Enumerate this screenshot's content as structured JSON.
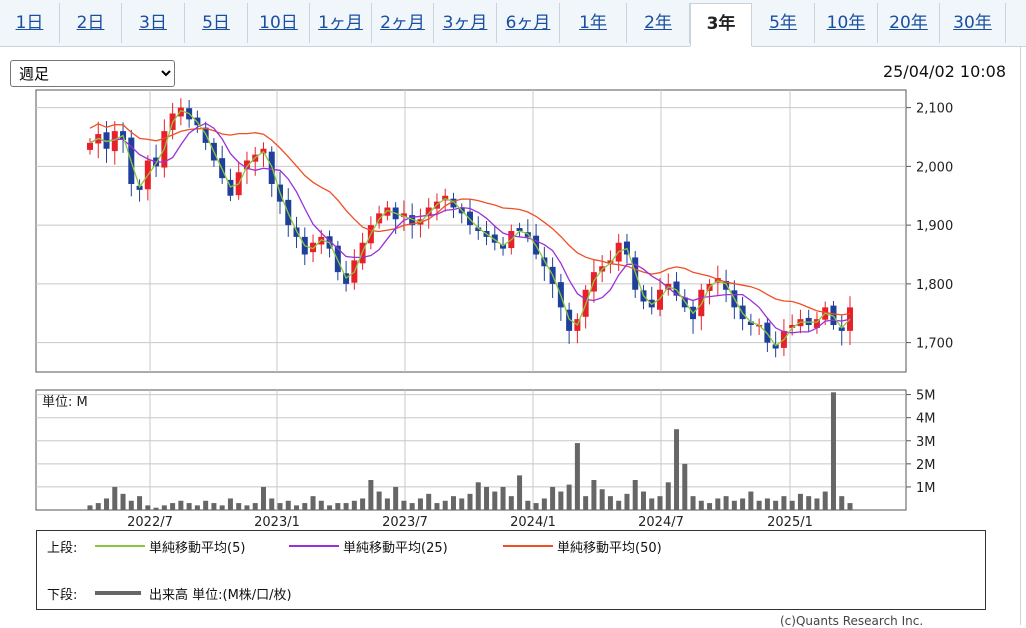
{
  "tabs": [
    {
      "label": "1日",
      "active": false
    },
    {
      "label": "2日",
      "active": false
    },
    {
      "label": "3日",
      "active": false
    },
    {
      "label": "5日",
      "active": false
    },
    {
      "label": "10日",
      "active": false
    },
    {
      "label": "1ヶ月",
      "active": false
    },
    {
      "label": "2ヶ月",
      "active": false
    },
    {
      "label": "3ヶ月",
      "active": false
    },
    {
      "label": "6ヶ月",
      "active": false
    },
    {
      "label": "1年",
      "active": false
    },
    {
      "label": "2年",
      "active": false
    },
    {
      "label": "3年",
      "active": true
    },
    {
      "label": "5年",
      "active": false
    },
    {
      "label": "10年",
      "active": false
    },
    {
      "label": "20年",
      "active": false
    },
    {
      "label": "30年",
      "active": false
    }
  ],
  "period_select": {
    "value": "週足"
  },
  "timestamp": "25/04/02 10:08",
  "legend": {
    "upper_label": "上段:",
    "ma5": "単純移動平均(5)",
    "ma25": "単純移動平均(25)",
    "ma50": "単純移動平均(50)",
    "lower_label": "下段:",
    "volume": "出来高 単位:(M株/口/枚)"
  },
  "copyright": "(c)Quants Research Inc.",
  "colors": {
    "up": "#e8202a",
    "down": "#1e3f9a",
    "ma5": "#8cc63f",
    "ma25": "#9b30d9",
    "ma50": "#f04e23",
    "volume": "#666666"
  },
  "chart_data": [
    {
      "type": "candlestick",
      "x_ticks": [
        "2022/7",
        "2023/1",
        "2023/7",
        "2024/1",
        "2024/7",
        "2025/1"
      ],
      "y_ticks": [
        "2,100",
        "2,000",
        "1,900",
        "1,800",
        "1,700"
      ],
      "ylim": [
        1650,
        2130
      ],
      "grid": true,
      "close_approx": [
        2040,
        2055,
        2030,
        2060,
        2045,
        1970,
        1960,
        2010,
        2000,
        2060,
        2090,
        2100,
        2080,
        2070,
        2040,
        2010,
        1980,
        1950,
        1990,
        2010,
        2020,
        2030,
        1970,
        1940,
        1900,
        1880,
        1850,
        1870,
        1880,
        1860,
        1820,
        1800,
        1840,
        1870,
        1900,
        1920,
        1930,
        1910,
        1920,
        1900,
        1910,
        1930,
        1940,
        1950,
        1930,
        1920,
        1900,
        1890,
        1880,
        1870,
        1860,
        1890,
        1890,
        1880,
        1850,
        1830,
        1800,
        1760,
        1720,
        1740,
        1790,
        1820,
        1830,
        1840,
        1870,
        1850,
        1790,
        1770,
        1760,
        1790,
        1800,
        1780,
        1760,
        1740,
        1790,
        1800,
        1810,
        1790,
        1760,
        1740,
        1730,
        1730,
        1700,
        1690,
        1720,
        1730,
        1740,
        1730,
        1740,
        1760,
        1730,
        1720,
        1760
      ]
    },
    {
      "type": "bar",
      "title": "単位: M",
      "y_ticks": [
        "5M",
        "4M",
        "3M",
        "2M",
        "1M"
      ],
      "ylim": [
        0,
        5.2
      ],
      "values_M": [
        0.2,
        0.3,
        0.5,
        1.0,
        0.7,
        0.4,
        0.6,
        0.2,
        0.1,
        0.2,
        0.3,
        0.4,
        0.3,
        0.2,
        0.4,
        0.3,
        0.2,
        0.5,
        0.3,
        0.2,
        0.3,
        1.0,
        0.5,
        0.3,
        0.4,
        0.2,
        0.3,
        0.6,
        0.4,
        0.2,
        0.3,
        0.3,
        0.4,
        0.5,
        1.3,
        0.8,
        0.5,
        1.0,
        0.4,
        0.3,
        0.5,
        0.7,
        0.3,
        0.4,
        0.6,
        0.5,
        0.7,
        1.2,
        1.0,
        0.8,
        1.0,
        0.6,
        1.5,
        0.4,
        0.3,
        0.5,
        1.0,
        0.8,
        1.1,
        2.9,
        0.6,
        1.3,
        0.9,
        0.6,
        0.4,
        0.7,
        1.3,
        0.8,
        0.5,
        0.6,
        1.2,
        3.5,
        2.0,
        0.6,
        0.4,
        0.3,
        0.5,
        0.6,
        0.4,
        0.5,
        0.8,
        0.4,
        0.5,
        0.4,
        0.6,
        0.4,
        0.7,
        0.6,
        0.5,
        0.8,
        5.1,
        0.6,
        0.3
      ]
    }
  ]
}
